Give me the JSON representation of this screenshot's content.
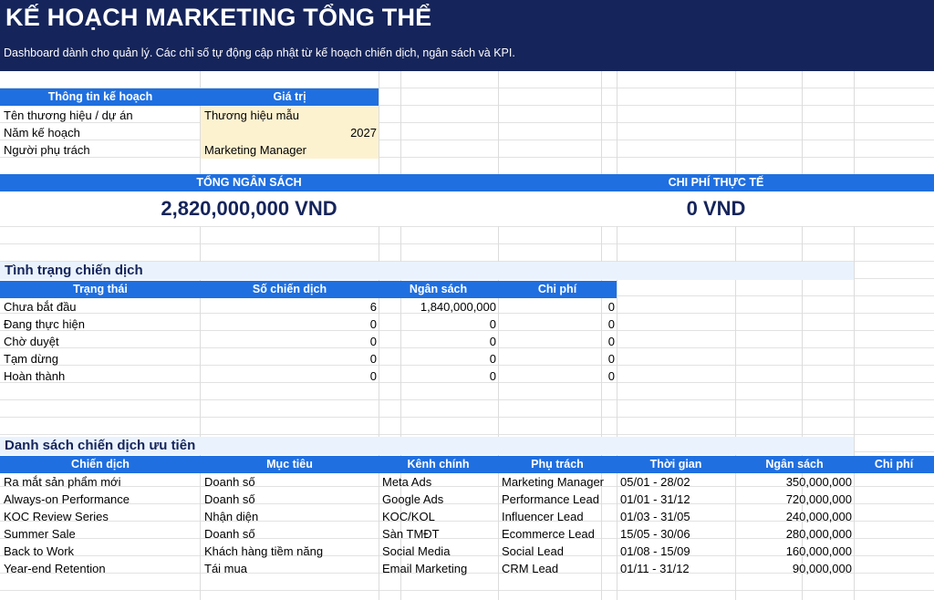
{
  "header": {
    "title": "KẾ HOẠCH MARKETING TỔNG THỂ",
    "subtitle": "Dashboard dành cho quản lý. Các chỉ số tự động cập nhật từ kế hoạch chiến dịch, ngân sách và KPI."
  },
  "plan_info": {
    "col1": "Thông tin kế hoạch",
    "col2": "Giá trị",
    "rows": [
      {
        "label": "Tên thương hiệu / dự án",
        "value": "Thương hiệu mẫu"
      },
      {
        "label": "Năm kế hoạch",
        "value": "2027"
      },
      {
        "label": "Người phụ trách",
        "value": "Marketing Manager"
      }
    ]
  },
  "summary": {
    "total_budget_label": "TỔNG NGÂN SÁCH",
    "total_budget_value": "2,820,000,000 VND",
    "actual_cost_label": "CHI PHÍ THỰC TẾ",
    "actual_cost_value": "0 VND"
  },
  "status_section": {
    "title": "Tình trạng chiến dịch",
    "headers": [
      "Trạng thái",
      "Số chiến dịch",
      "Ngân sách",
      "Chi phí"
    ],
    "rows": [
      {
        "status": "Chưa bắt đầu",
        "count": "6",
        "budget": "1,840,000,000",
        "cost": "0"
      },
      {
        "status": "Đang thực hiện",
        "count": "0",
        "budget": "0",
        "cost": "0"
      },
      {
        "status": "Chờ duyệt",
        "count": "0",
        "budget": "0",
        "cost": "0"
      },
      {
        "status": "Tạm dừng",
        "count": "0",
        "budget": "0",
        "cost": "0"
      },
      {
        "status": "Hoàn thành",
        "count": "0",
        "budget": "0",
        "cost": "0"
      }
    ]
  },
  "priority_section": {
    "title": "Danh sách chiến dịch ưu tiên",
    "headers": [
      "Chiến dịch",
      "Mục tiêu",
      "Kênh chính",
      "Phụ trách",
      "Thời gian",
      "Ngân sách",
      "Chi phí"
    ],
    "rows": [
      {
        "campaign": "Ra mắt sản phẩm mới",
        "goal": "Doanh số",
        "channel": "Meta Ads",
        "owner": "Marketing Manager",
        "time": "05/01 - 28/02",
        "budget": "350,000,000"
      },
      {
        "campaign": "Always-on Performance",
        "goal": "Doanh số",
        "channel": "Google Ads",
        "owner": "Performance Lead",
        "time": "01/01 - 31/12",
        "budget": "720,000,000"
      },
      {
        "campaign": "KOC Review Series",
        "goal": "Nhận diện",
        "channel": "KOC/KOL",
        "owner": "Influencer Lead",
        "time": "01/03 - 31/05",
        "budget": "240,000,000"
      },
      {
        "campaign": "Summer Sale",
        "goal": "Doanh số",
        "channel": "Sàn TMĐT",
        "owner": "Ecommerce Lead",
        "time": "15/05 - 30/06",
        "budget": "280,000,000"
      },
      {
        "campaign": "Back to Work",
        "goal": "Khách hàng tiềm năng",
        "channel": "Social Media",
        "owner": "Social Lead",
        "time": "01/08 - 15/09",
        "budget": "160,000,000"
      },
      {
        "campaign": "Year-end Retention",
        "goal": "Tái mua",
        "channel": "Email Marketing",
        "owner": "CRM Lead",
        "time": "01/11 - 31/12",
        "budget": "90,000,000"
      }
    ]
  }
}
